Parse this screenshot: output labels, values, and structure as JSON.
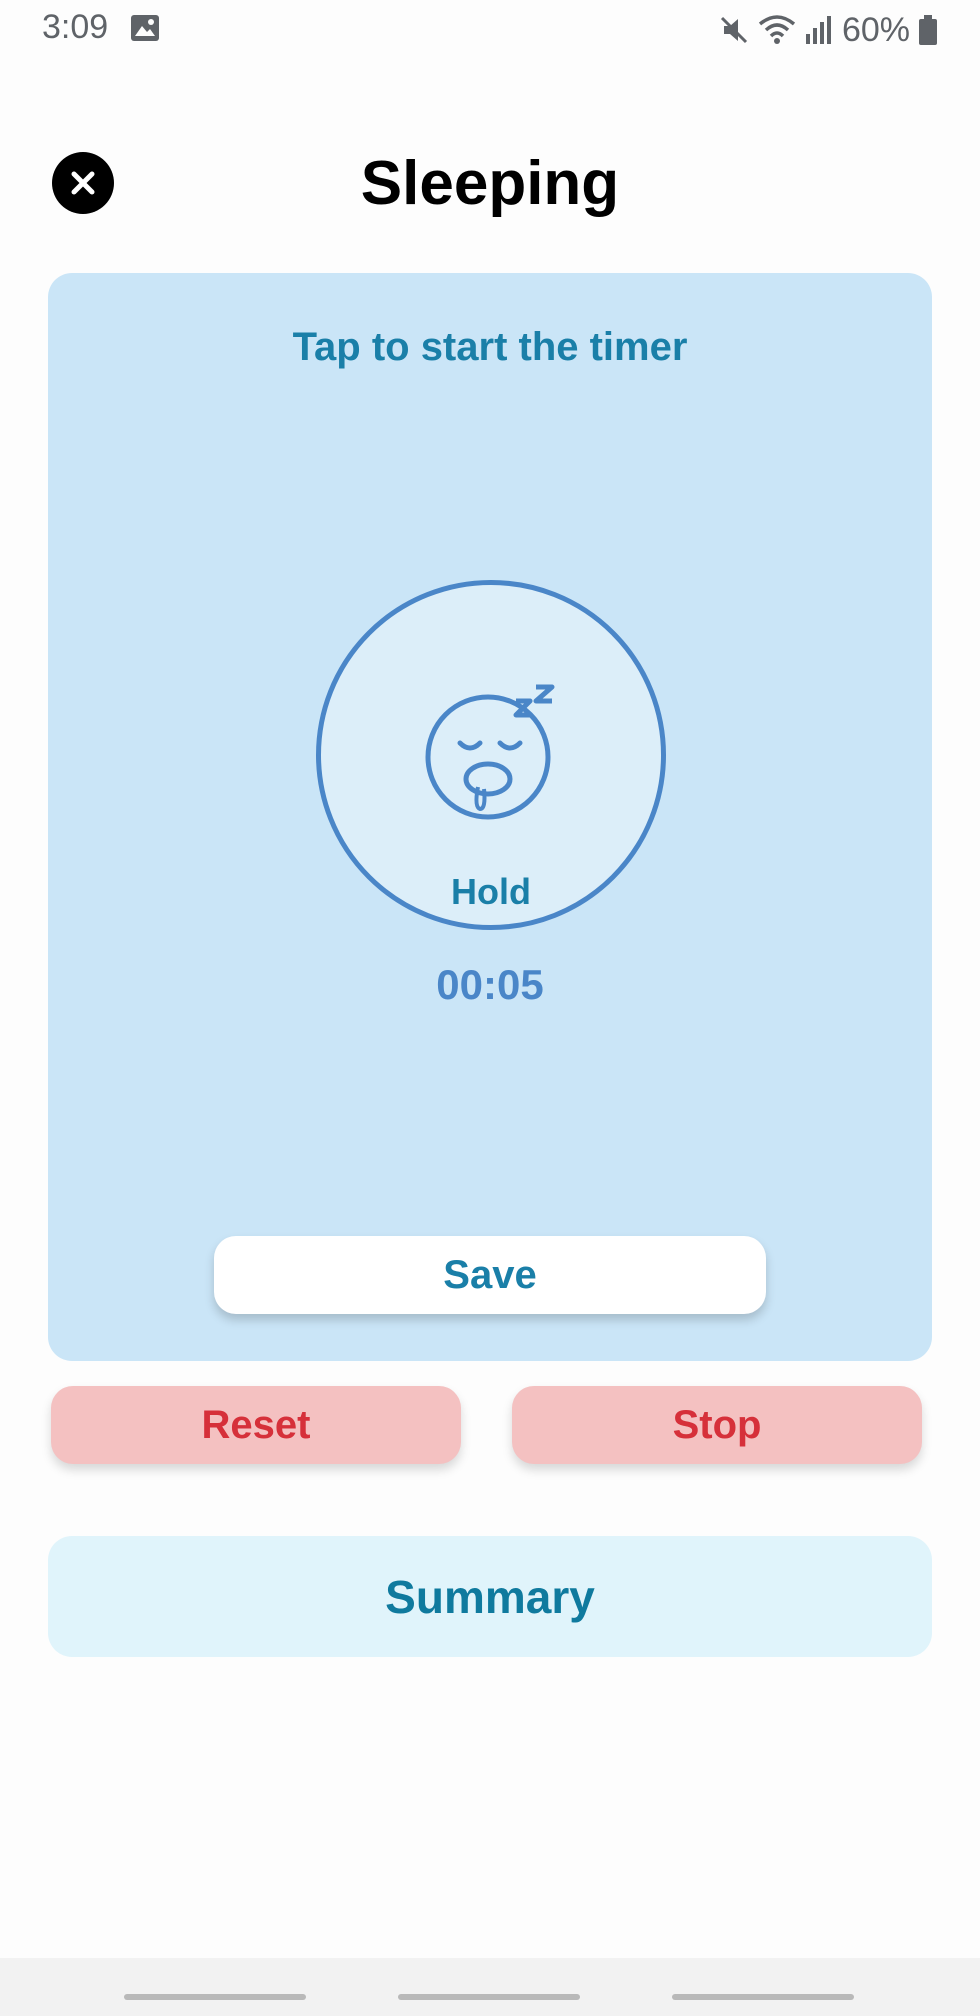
{
  "status_bar": {
    "time": "3:09",
    "battery": "60%",
    "icons": [
      "gallery-icon",
      "mute-icon",
      "wifi-icon",
      "signal-icon",
      "battery-icon"
    ]
  },
  "header": {
    "title": "Sleeping",
    "close_icon": "close-circle-icon"
  },
  "timer": {
    "hint": "Tap to start the timer",
    "icon": "sleeping-face-icon",
    "hold_label": "Hold",
    "elapsed": "00:05",
    "save_label": "Save"
  },
  "actions": {
    "reset_label": "Reset",
    "stop_label": "Stop"
  },
  "summary": {
    "label": "Summary"
  },
  "colors": {
    "card_background": "#cae5f7",
    "accent_text": "#1a7fa8",
    "circle_border": "#4a86c8",
    "danger_background": "#f4c1c1",
    "danger_text": "#d6303a",
    "summary_background": "#e0f4fb"
  }
}
